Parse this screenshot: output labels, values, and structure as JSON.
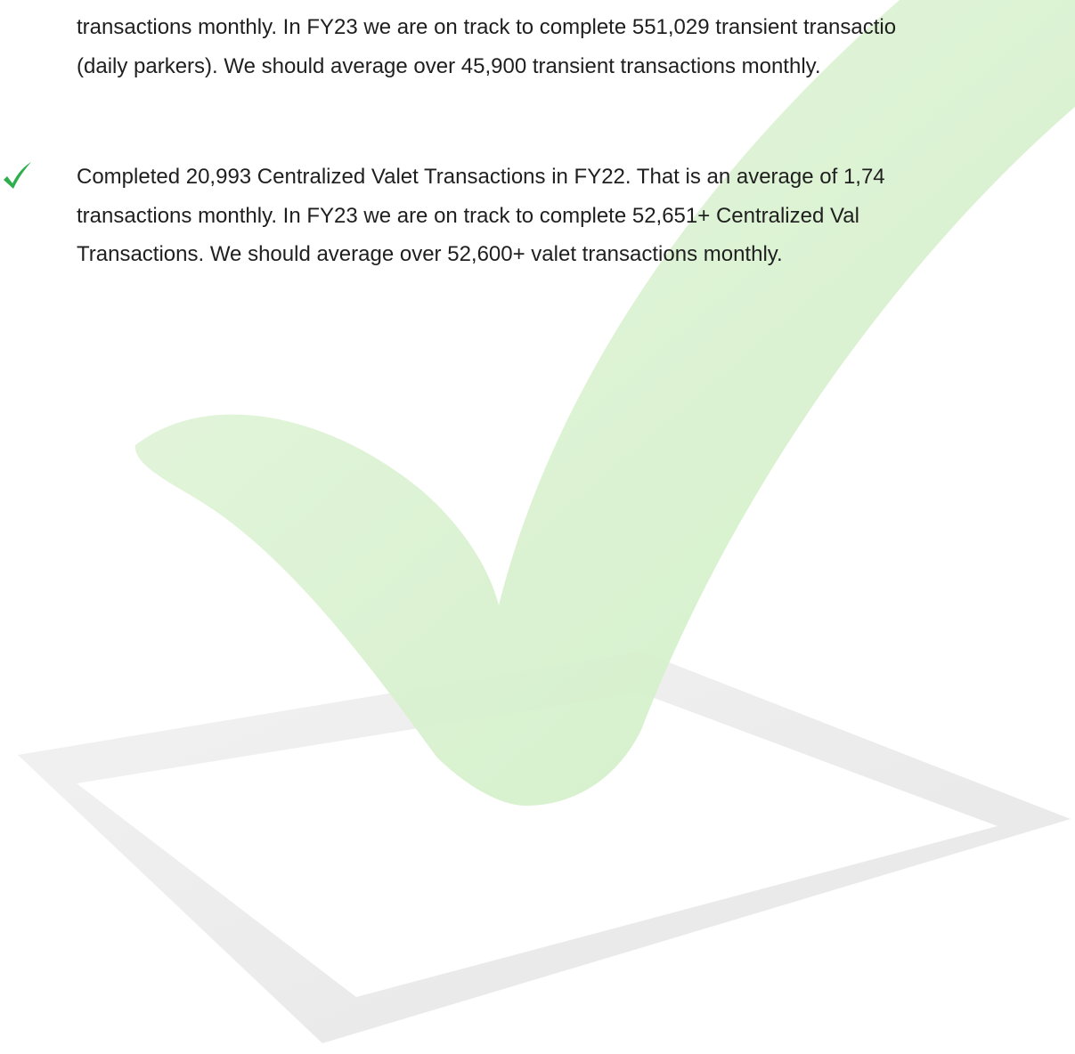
{
  "document": {
    "paragraph_1": {
      "line_1": "transactions monthly.  In FY23 we are on track to complete 551,029 transient transactio",
      "line_2": "(daily parkers).  We should average over 45,900 transient transactions monthly."
    },
    "paragraph_2": {
      "bullet_icon": "green-checkmark-icon",
      "line_1": "Completed 20,993 Centralized Valet Transactions in FY22.  That is an average of 1,74",
      "line_2": "transactions monthly.  In FY23 we are on track to complete 52,651+ Centralized Val",
      "line_3": "Transactions. We should average over 52,600+ valet transactions monthly."
    },
    "watermark": {
      "icon": "checkbox-checkmark-watermark",
      "check_color": "#d5f0cc",
      "box_color": "#eeeeee"
    },
    "colors": {
      "bullet_check": "#2fae4e",
      "text": "#1f1f1f"
    }
  }
}
